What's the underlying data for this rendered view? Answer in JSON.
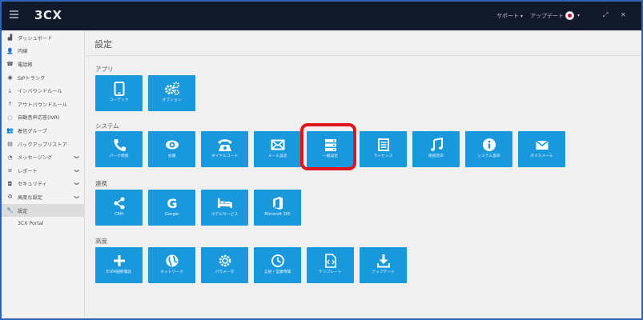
{
  "topbar": {
    "logo": "3CX",
    "support_label": "サポート",
    "update_label": "アップデート",
    "caret": "▾"
  },
  "sidebar": {
    "items": [
      {
        "icon": "dashboard-icon",
        "glyph": "▟",
        "label": "ダッシュボード",
        "chevron": false
      },
      {
        "icon": "user-icon",
        "glyph": "👤",
        "label": "内線",
        "chevron": false
      },
      {
        "icon": "phonebook-icon",
        "glyph": "☎",
        "label": "電話帳",
        "chevron": false
      },
      {
        "icon": "sip-trunk-icon",
        "glyph": "◉",
        "label": "SIPトランク",
        "chevron": false
      },
      {
        "icon": "inbound-icon",
        "glyph": "↓",
        "label": "インバウンドルール",
        "chevron": false
      },
      {
        "icon": "outbound-icon",
        "glyph": "↑",
        "label": "アウトバウンドルール",
        "chevron": false
      },
      {
        "icon": "ivr-icon",
        "glyph": "◌",
        "label": "自動音声応答(IVR)",
        "chevron": false
      },
      {
        "icon": "ring-group-icon",
        "glyph": "👥",
        "label": "着信グループ",
        "chevron": false
      },
      {
        "icon": "backup-icon",
        "glyph": "▤",
        "label": "バックアップリストア",
        "chevron": false
      },
      {
        "icon": "messaging-icon",
        "glyph": "◔",
        "label": "メッセージング",
        "chevron": true
      },
      {
        "icon": "report-icon",
        "glyph": "≡",
        "label": "レポート",
        "chevron": true
      },
      {
        "icon": "security-icon",
        "glyph": "◘",
        "label": "セキュリティ",
        "chevron": true
      },
      {
        "icon": "advanced-icon",
        "glyph": "⚙",
        "label": "高度な設定",
        "chevron": true
      },
      {
        "icon": "settings-icon",
        "glyph": "🔧",
        "label": "設定",
        "chevron": false,
        "active": true
      },
      {
        "icon": "",
        "glyph": "",
        "label": "3CX Portal",
        "chevron": false
      }
    ],
    "chevron_glyph": "❯"
  },
  "main": {
    "title": "設定",
    "sections": {
      "apps": "アプリ",
      "system": "システム",
      "integration": "連携",
      "advanced": "高度"
    },
    "tiles": {
      "codec": "コーデック",
      "options": "オプション",
      "park": "パーク保留",
      "conference": "会議",
      "dial_codes": "ダイヤルコード",
      "email_settings": "メール設定",
      "general": "一般設定",
      "license": "ライセンス",
      "hold_music": "保留音声",
      "system_prompts": "システム音声",
      "voicemail": "ボイスメール",
      "crm": "CRM",
      "google": "Google",
      "hotel": "ホテルサービス",
      "m365": "Microsoft 365",
      "e164": "E164国際電話",
      "network": "ネットワーク",
      "parameters": "パラメータ",
      "language_hours": "言語・営業時間",
      "templates": "テンプレート",
      "updates": "アップデート"
    }
  },
  "colors": {
    "tile": "#1a98dc",
    "topbar": "#11192a",
    "highlight": "#e0141b",
    "frame": "#2e64b6"
  }
}
